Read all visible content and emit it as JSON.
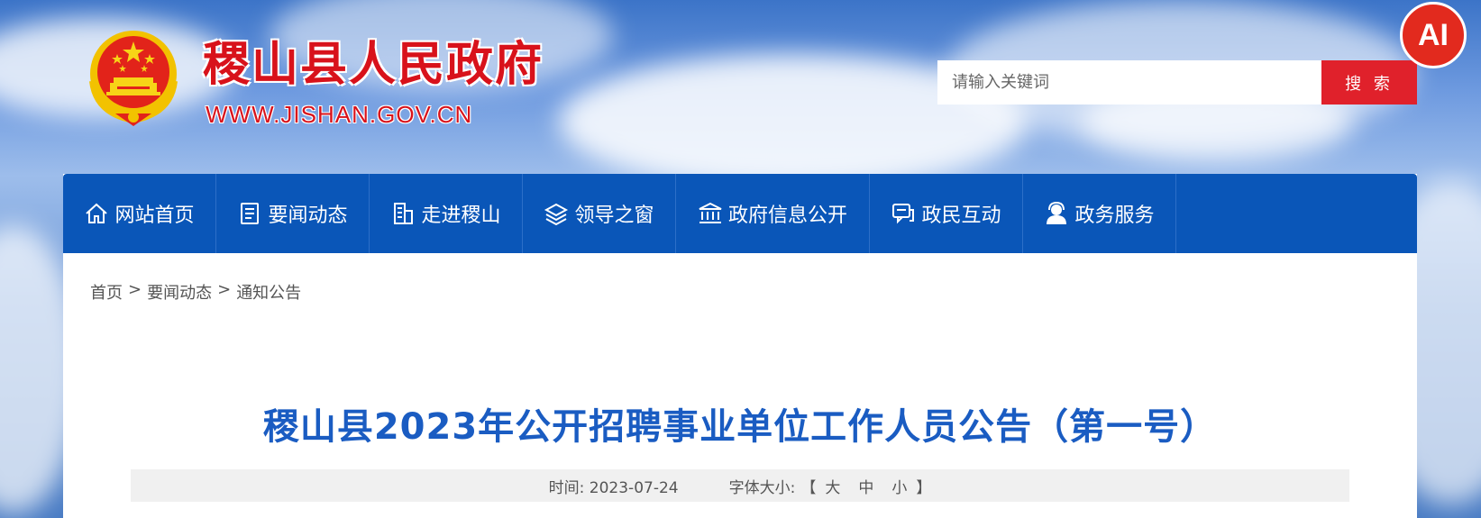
{
  "header": {
    "site_title": "稷山县人民政府",
    "site_url": "WWW.JISHAN.GOV.CN",
    "search_placeholder": "请输入关键词",
    "search_button": "搜 索",
    "ai_badge": "AI"
  },
  "nav": {
    "items": [
      {
        "label": "网站首页",
        "icon": "home-icon"
      },
      {
        "label": "要闻动态",
        "icon": "news-icon"
      },
      {
        "label": "走进稷山",
        "icon": "building-icon"
      },
      {
        "label": "领导之窗",
        "icon": "layers-icon"
      },
      {
        "label": "政府信息公开",
        "icon": "government-icon"
      },
      {
        "label": "政民互动",
        "icon": "chat-icon"
      },
      {
        "label": "政务服务",
        "icon": "user-service-icon"
      }
    ]
  },
  "breadcrumb": {
    "home": "首页",
    "separator": ">",
    "level1": "要闻动态",
    "level2": "通知公告"
  },
  "article": {
    "title": "稷山县2023年公开招聘事业单位工作人员公告（第一号）",
    "time_label": "时间:",
    "time_value": "2023-07-24",
    "font_size_label": "字体大小:",
    "bracket_open": "【",
    "font_large": "大",
    "font_medium": "中",
    "font_small": "小",
    "bracket_close": "】"
  },
  "colors": {
    "brand_red": "#d8121b",
    "nav_blue": "#0a56b8",
    "title_blue": "#1a5cc2",
    "search_red": "#e0212b"
  }
}
